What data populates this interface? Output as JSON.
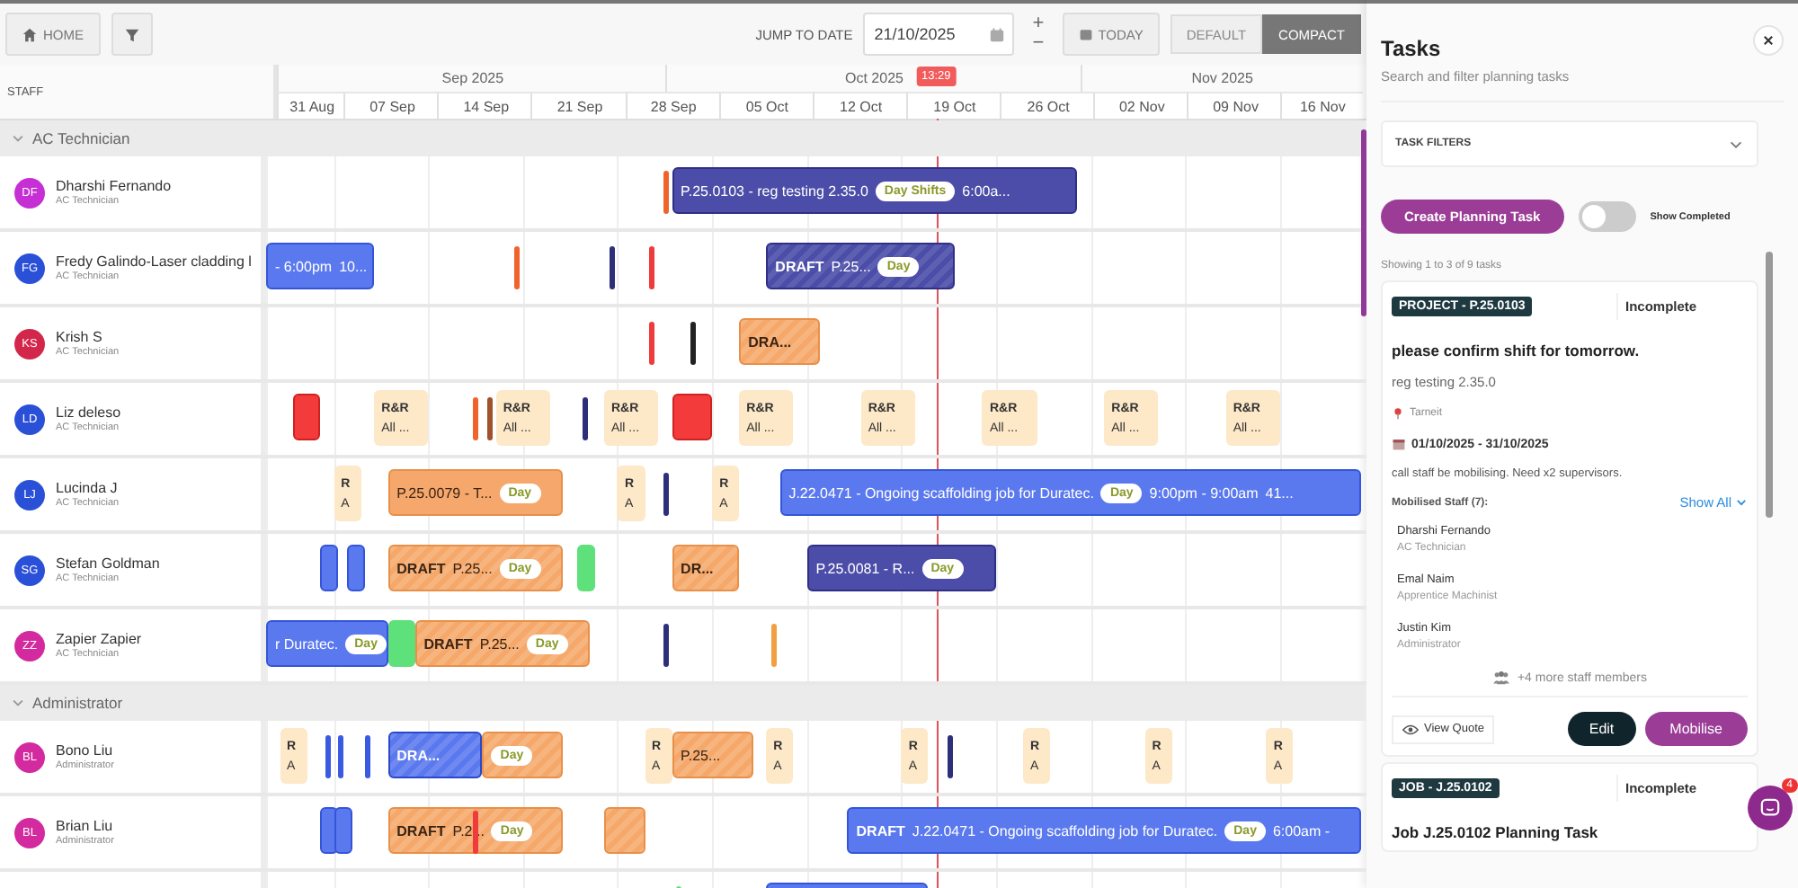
{
  "toolbar": {
    "home": "HOME",
    "jump_label": "JUMP TO DATE",
    "date": "21/10/2025",
    "zoom_in": "+",
    "zoom_out": "−",
    "today": "TODAY",
    "views": [
      {
        "label": "DEFAULT",
        "selected": false
      },
      {
        "label": "COMPACT",
        "selected": true
      }
    ]
  },
  "timeline": {
    "staff_header": "STAFF",
    "now": {
      "time": "13:29"
    },
    "months": [
      {
        "label": "Sep 2025"
      },
      {
        "label": "Oct 2025"
      },
      {
        "label": "Nov 2025"
      }
    ],
    "weeks": [
      {
        "label": "31 Aug"
      },
      {
        "label": "07 Sep"
      },
      {
        "label": "14 Sep"
      },
      {
        "label": "21 Sep"
      },
      {
        "label": "28 Sep"
      },
      {
        "label": "05 Oct"
      },
      {
        "label": "12 Oct"
      },
      {
        "label": "19 Oct"
      },
      {
        "label": "26 Oct"
      },
      {
        "label": "02 Nov"
      },
      {
        "label": "09 Nov"
      },
      {
        "label": "16 Nov"
      }
    ]
  },
  "groups": [
    {
      "name": "AC Technician",
      "expanded": true,
      "rows": [
        {
          "initials": "DF",
          "name": "Dharshi Fernando",
          "role": "AC Technician",
          "color": "#c62fd3",
          "bars": [
            {
              "kind": "marker",
              "color": "#f0642c"
            },
            {
              "kind": "project",
              "label": "P.25.0103 - reg testing 2.35.0",
              "badge": "Day Shifts",
              "time": "6:00a..."
            }
          ]
        },
        {
          "initials": "FG",
          "name": "Fredy Galindo-Laser cladding l",
          "role": "AC Technician",
          "color": "#2b50d8",
          "bars": [
            {
              "kind": "job",
              "label": "- 6:00pm",
              "time": "10..."
            },
            {
              "kind": "marker",
              "color": "#f0642c"
            },
            {
              "kind": "marker",
              "color": "#2d2f7a"
            },
            {
              "kind": "marker",
              "color": "#ef3b3b"
            },
            {
              "kind": "draft_project",
              "tag": "DRAFT",
              "label": "P.25...",
              "badge": "Day"
            }
          ]
        },
        {
          "initials": "KS",
          "name": "Krish S",
          "role": "AC Technician",
          "color": "#d3264b",
          "bars": [
            {
              "kind": "marker",
              "color": "#ef3b3b"
            },
            {
              "kind": "marker",
              "color": "#222222"
            },
            {
              "kind": "draft",
              "tag": "DRA..."
            }
          ]
        },
        {
          "initials": "LD",
          "name": "Liz deleso",
          "role": "AC Technician",
          "color": "#2b50d8",
          "bars": [
            {
              "kind": "leave"
            },
            {
              "kind": "rr",
              "tag": "R&R",
              "label": "All ..."
            },
            {
              "kind": "marker",
              "color": "#f0642c"
            },
            {
              "kind": "marker",
              "color": "#a0522d"
            },
            {
              "kind": "rr",
              "tag": "R&R",
              "label": "All ..."
            },
            {
              "kind": "marker",
              "color": "#2d2f7a"
            },
            {
              "kind": "rr",
              "tag": "R&R",
              "label": "All ..."
            },
            {
              "kind": "leave"
            },
            {
              "kind": "rr",
              "tag": "R&R",
              "label": "All ..."
            },
            {
              "kind": "rr",
              "tag": "R&R",
              "label": "All ..."
            },
            {
              "kind": "rr",
              "tag": "R&R",
              "label": "All ..."
            },
            {
              "kind": "rr",
              "tag": "R&R",
              "label": "All ..."
            },
            {
              "kind": "rr",
              "tag": "R&R",
              "label": "All ..."
            }
          ]
        },
        {
          "initials": "LJ",
          "name": "Lucinda J",
          "role": "AC Technician",
          "color": "#2b50d8",
          "bars": [
            {
              "kind": "rr",
              "tag": "R",
              "label": "A"
            },
            {
              "kind": "task",
              "label": "P.25.0079 - T...",
              "badge": "Day"
            },
            {
              "kind": "rr",
              "tag": "R",
              "label": "A"
            },
            {
              "kind": "marker",
              "color": "#2d2f7a"
            },
            {
              "kind": "rr",
              "tag": "R",
              "label": "A"
            },
            {
              "kind": "job",
              "label": "J.22.0471 - Ongoing scaffolding job for Duratec.",
              "badge": "Day",
              "time": "9:00pm - 9:00am",
              "extra": "41..."
            }
          ]
        },
        {
          "initials": "SG",
          "name": "Stefan Goldman",
          "role": "AC Technician",
          "color": "#2b50d8",
          "bars": [
            {
              "kind": "job"
            },
            {
              "kind": "job"
            },
            {
              "kind": "draft",
              "tag": "DRAFT",
              "label": "P.25...",
              "badge": "Day"
            },
            {
              "kind": "block",
              "color": "#5ee07a"
            },
            {
              "kind": "draft",
              "tag": "DR..."
            },
            {
              "kind": "project",
              "label": "P.25.0081 - R...",
              "badge": "Day"
            }
          ]
        },
        {
          "initials": "ZZ",
          "name": "Zapier Zapier",
          "role": "AC Technician",
          "color": "#d42a9f",
          "bars": [
            {
              "kind": "job",
              "label": "r Duratec.",
              "badge": "Day"
            },
            {
              "kind": "block",
              "color": "#5ee07a"
            },
            {
              "kind": "draft",
              "tag": "DRAFT",
              "label": "P.25...",
              "badge": "Day"
            },
            {
              "kind": "marker",
              "color": "#2d2f7a"
            },
            {
              "kind": "marker",
              "color": "#f0a040"
            }
          ]
        }
      ]
    },
    {
      "name": "Administrator",
      "expanded": true,
      "rows": [
        {
          "initials": "BL",
          "name": "Bono Liu",
          "role": "Administrator",
          "color": "#d42a9f",
          "bars": [
            {
              "kind": "rr",
              "tag": "R",
              "label": "A"
            },
            {
              "kind": "marker",
              "color": "#3a5be0"
            },
            {
              "kind": "marker",
              "color": "#3a5be0"
            },
            {
              "kind": "marker",
              "color": "#3a5be0"
            },
            {
              "kind": "draft_job",
              "tag": "DRA..."
            },
            {
              "kind": "draft",
              "badge": "Day"
            },
            {
              "kind": "rr",
              "tag": "R",
              "label": "A"
            },
            {
              "kind": "draft",
              "label": "P.25..."
            },
            {
              "kind": "rr",
              "tag": "R",
              "label": "A"
            },
            {
              "kind": "rr",
              "tag": "R",
              "label": "A"
            },
            {
              "kind": "marker",
              "color": "#2d2f7a"
            },
            {
              "kind": "rr",
              "tag": "R",
              "label": "A"
            },
            {
              "kind": "rr",
              "tag": "R",
              "label": "A"
            },
            {
              "kind": "rr",
              "tag": "R",
              "label": "A"
            }
          ]
        },
        {
          "initials": "BL",
          "name": "Brian Liu",
          "role": "Administrator",
          "color": "#d42a9f",
          "bars": [
            {
              "kind": "job"
            },
            {
              "kind": "job"
            },
            {
              "kind": "draft",
              "tag": "DRAFT",
              "label": "P.2...",
              "badge": "Day"
            },
            {
              "kind": "marker",
              "color": "#ef3b3b"
            },
            {
              "kind": "draft"
            },
            {
              "kind": "job",
              "tag": "DRAFT",
              "label": "J.22.0471 - Ongoing scaffolding job for Duratec.",
              "badge": "Day",
              "time": "6:00am -"
            }
          ]
        },
        {
          "bars": [
            {
              "kind": "marker",
              "color": "#5ee07a"
            },
            {
              "kind": "job"
            }
          ]
        }
      ]
    }
  ],
  "panel": {
    "title": "Tasks",
    "subtitle": "Search and filter planning tasks",
    "filters": {
      "label": "TASK FILTERS",
      "expanded": false
    },
    "create": "Create Planning Task",
    "show_completed": {
      "label": "Show Completed",
      "on": false
    },
    "showing": "Showing 1 to 3 of 9 tasks",
    "tasks": [
      {
        "tag": "PROJECT - P.25.0103",
        "status": "Incomplete",
        "title": "please confirm shift for tomorrow.",
        "subtitle": "reg testing 2.35.0",
        "location": "Tarneit",
        "dates": "01/10/2025 - 31/10/2025",
        "note": "call staff be mobilising. Need x2 supervisors.",
        "staff_heading": "Mobilised Staff (7):",
        "show_all": "Show All",
        "staff": [
          {
            "name": "Dharshi Fernando",
            "role": "AC Technician"
          },
          {
            "name": "Emal Naim",
            "role": "Apprentice Machinist"
          },
          {
            "name": "Justin Kim",
            "role": "Administrator"
          }
        ],
        "more": "+4 more staff members",
        "view": "View Quote",
        "edit": "Edit",
        "mobilise": "Mobilise"
      },
      {
        "tag": "JOB - J.25.0102",
        "status": "Incomplete",
        "title": "Job J.25.0102 Planning Task"
      }
    ],
    "chat_badge": "4"
  }
}
